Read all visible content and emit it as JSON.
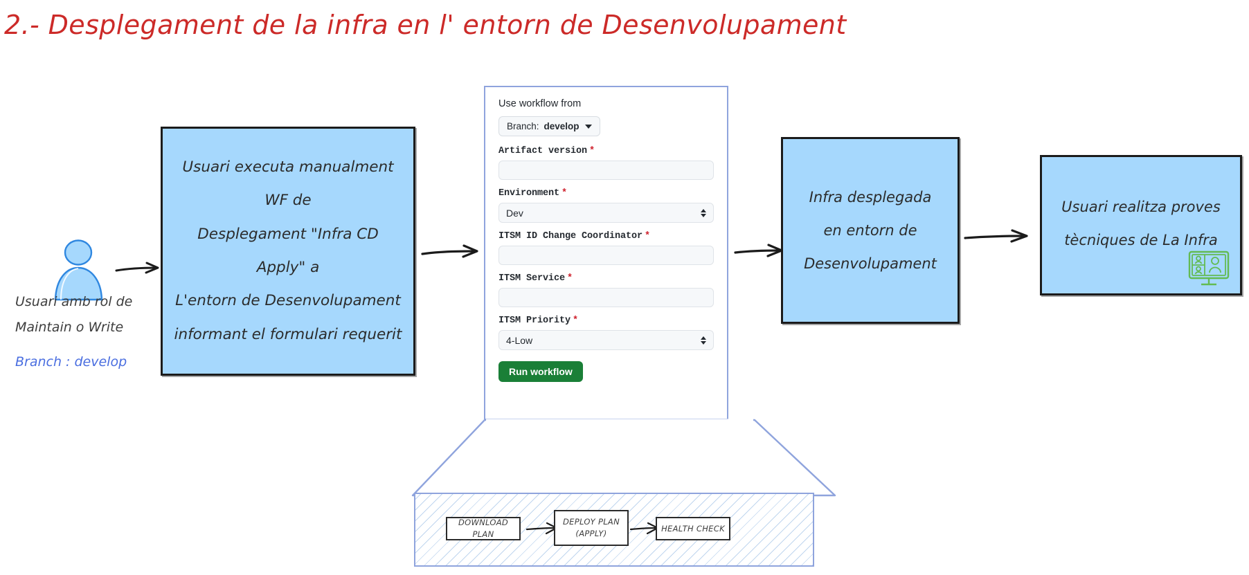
{
  "title": "2.- Desplegament de la infra en l' entorn de Desenvolupament",
  "actor": {
    "icon": "user-person-icon",
    "label_line1": "Usuari amb rol de",
    "label_line2": "Maintain o Write",
    "branch_note": "Branch : develop",
    "branch_color": "#4a6ee0"
  },
  "boxes": {
    "execute": {
      "line1": "Usuari executa manualment WF de",
      "line2": "Desplegament \"Infra CD Apply\" a",
      "line3": "L'entorn de Desenvolupament",
      "line4": "informant el formulari requerit",
      "fill": "#a6d8fd"
    },
    "infra": {
      "line1": "Infra desplegada",
      "line2": "en entorn de",
      "line3": "Desenvolupament",
      "fill": "#a6d8fd"
    },
    "proves": {
      "line1": "Usuari realitza proves",
      "line2": "tècniques de La Infra",
      "fill": "#a6d8fd",
      "icon": "video-conference-monitor-icon",
      "icon_color": "#63bb52"
    }
  },
  "workflow_form": {
    "use_workflow_from_label": "Use workflow from",
    "branch_button": {
      "prefix": "Branch:",
      "value": "develop"
    },
    "fields": [
      {
        "label": "Artifact version",
        "required": true,
        "type": "text",
        "value": ""
      },
      {
        "label": "Environment",
        "required": true,
        "type": "select",
        "value": "Dev"
      },
      {
        "label": "ITSM ID Change Coordinator",
        "required": true,
        "type": "text",
        "value": ""
      },
      {
        "label": "ITSM Service",
        "required": true,
        "type": "text",
        "value": ""
      },
      {
        "label": "ITSM Priority",
        "required": true,
        "type": "select",
        "value": "4-Low"
      }
    ],
    "required_marker": "*",
    "run_button": "Run workflow",
    "run_button_color": "#1a7f37"
  },
  "detail_panel": {
    "steps": [
      {
        "line1": "DOWNLOAD PLAN",
        "line2": ""
      },
      {
        "line1": "DEPLOY PLAN",
        "line2": "(APPLY)"
      },
      {
        "line1": "HEALTH CHECK",
        "line2": ""
      }
    ]
  }
}
